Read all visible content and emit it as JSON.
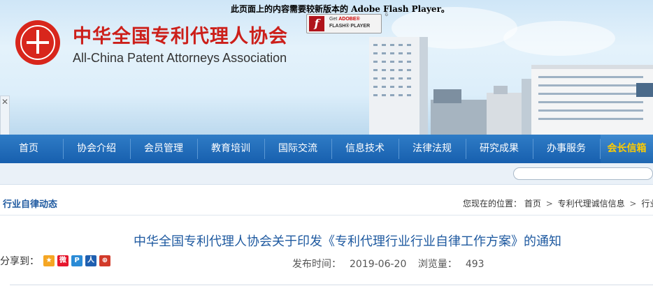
{
  "banner": {
    "flash_notice": "此页面上的内容需要较新版本的 Adobe Flash Player。",
    "org_name_cn": "中华全国专利代理人协会",
    "org_name_en": "All-China Patent Attorneys Association",
    "flash_badge_line1_prefix": "Get ",
    "flash_badge_line1_brand": "ADOBE®",
    "flash_badge_line2": "FLASH® PLAYER",
    "flash_badge_letter": "f",
    "side_close": "✕"
  },
  "nav": {
    "items": [
      {
        "label": "首页"
      },
      {
        "label": "协会介绍"
      },
      {
        "label": "会员管理"
      },
      {
        "label": "教育培训"
      },
      {
        "label": "国际交流"
      },
      {
        "label": "信息技术"
      },
      {
        "label": "法律法规"
      },
      {
        "label": "研究成果"
      },
      {
        "label": "办事服务"
      },
      {
        "label": "会长信箱"
      }
    ],
    "active_index": 9
  },
  "section": {
    "title": "行业自律动态",
    "breadcrumb_prefix": "您现在的位置：",
    "crumbs": [
      "首页",
      "专利代理诚信信息",
      "行业自"
    ]
  },
  "article": {
    "title": "中华全国专利代理人协会关于印发《专利代理行业行业自律工作方案》的通知",
    "share_label": "分享到：",
    "publish_label": "发布时间：",
    "publish_date": "2019-06-20",
    "views_label": "浏览量：",
    "views": "493"
  },
  "share_icons": [
    {
      "name": "qzone-icon",
      "color": "#f5a623",
      "glyph": "★"
    },
    {
      "name": "weibo-icon",
      "color": "#e6162d",
      "glyph": "微"
    },
    {
      "name": "tqq-icon",
      "color": "#2a8bd6",
      "glyph": "P"
    },
    {
      "name": "renren-icon",
      "color": "#1f5fb0",
      "glyph": "人"
    },
    {
      "name": "more-share-icon",
      "color": "#d23a2a",
      "glyph": "⊕"
    }
  ],
  "colors": {
    "nav_bg": "#175fae",
    "active_nav_text": "#ffcc00",
    "brand_red": "#cc1f1a",
    "link_blue": "#1f5aa0"
  }
}
